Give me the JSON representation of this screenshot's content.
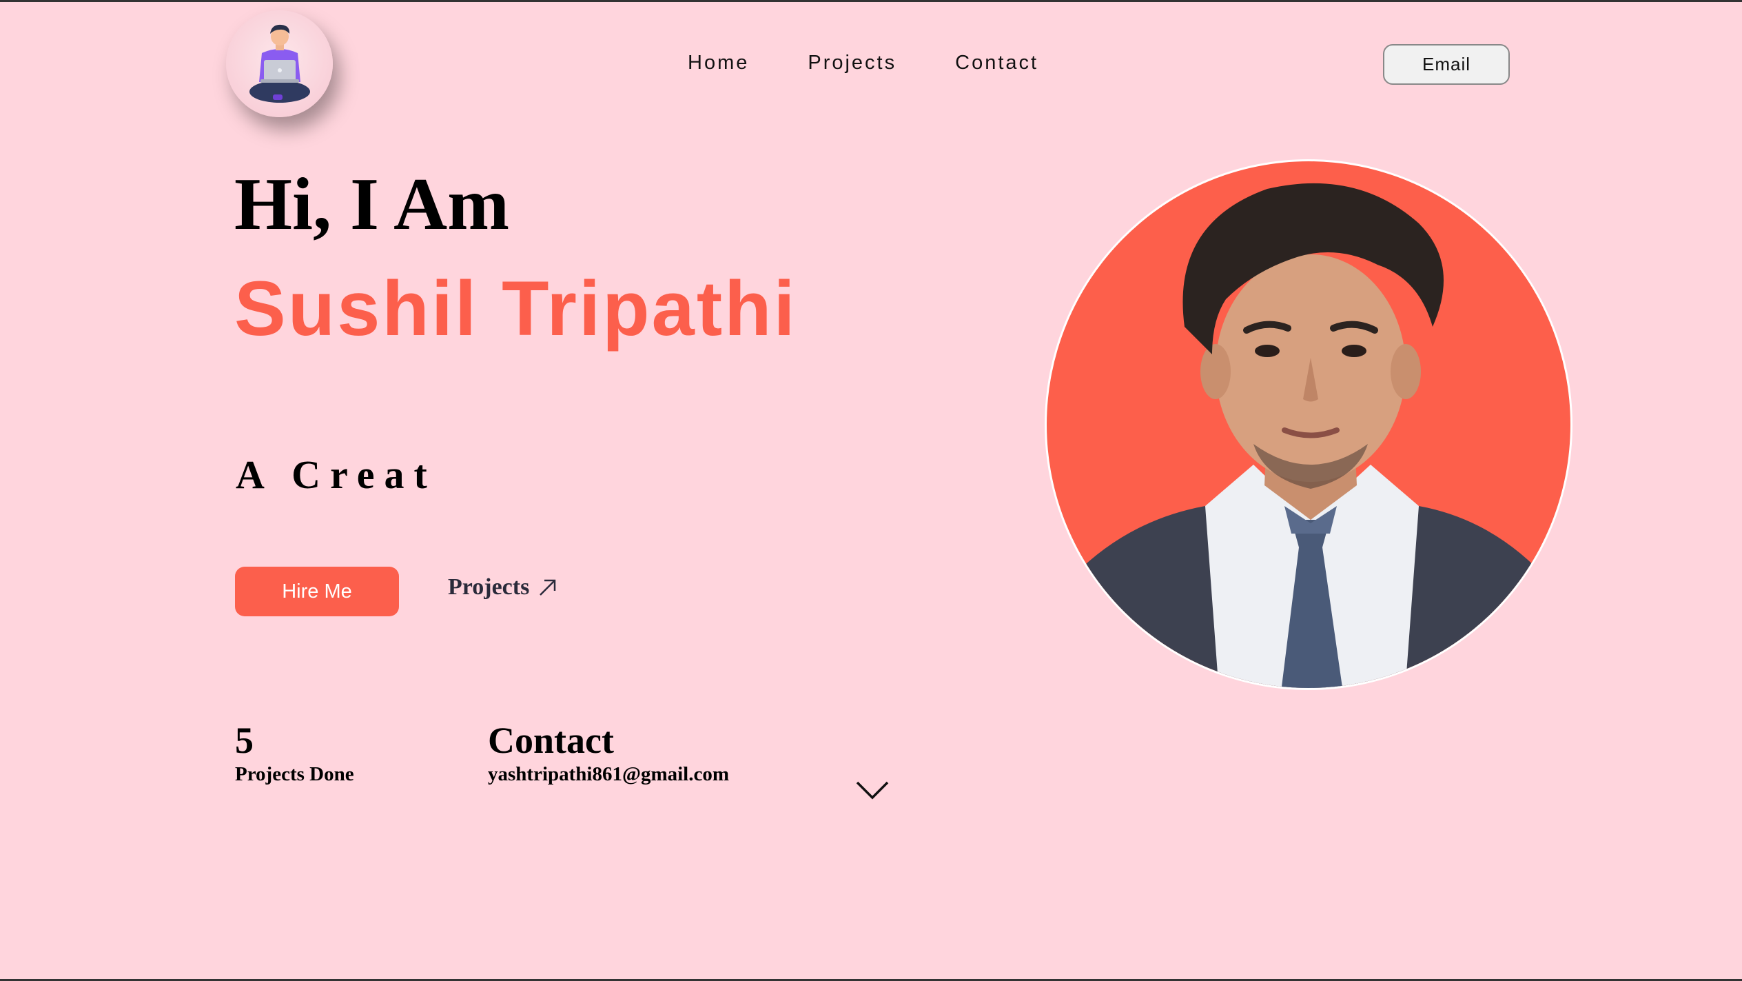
{
  "header": {
    "logo_icon": "developer-with-laptop-avatar",
    "nav": [
      {
        "label": "Home"
      },
      {
        "label": "Projects"
      },
      {
        "label": "Contact"
      }
    ],
    "email_button": "Email"
  },
  "hero": {
    "greeting": "Hi, I Am",
    "name": "Sushil Tripathi",
    "typed_text": "A Creat",
    "hire_button": "Hire Me",
    "projects_link": "Projects",
    "projects_link_icon": "arrow-up-right-icon"
  },
  "stats": {
    "projects_count": "5",
    "projects_label": "Projects Done",
    "contact_title": "Contact",
    "contact_email": "yashtripathi861@gmail.com"
  },
  "scroll_icon": "chevron-down-icon",
  "portrait_icon": "profile-photo",
  "colors": {
    "background": "#ffd5dd",
    "accent": "#fc5f4c",
    "text": "#000000"
  }
}
